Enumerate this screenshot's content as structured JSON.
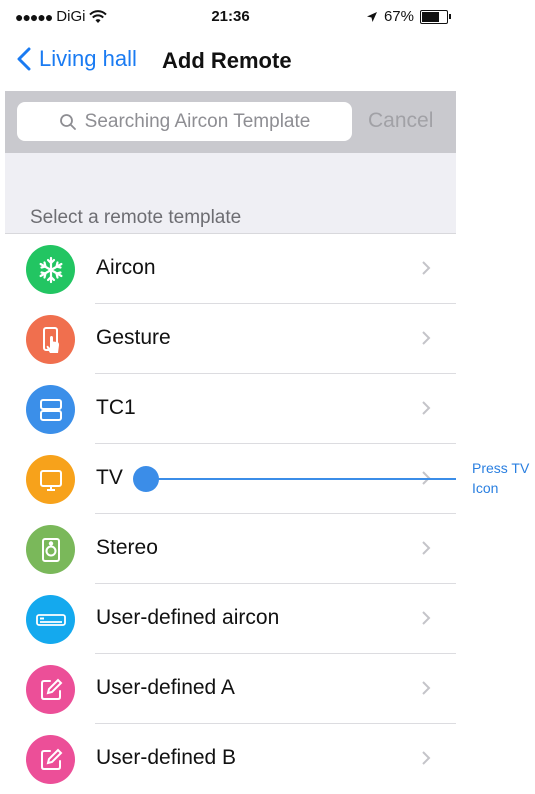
{
  "status_bar": {
    "signal": "●●●●●",
    "carrier": "DiGi",
    "time": "21:36",
    "battery": "67%",
    "battery_level": 0.67
  },
  "nav": {
    "back_label": "Living hall",
    "title": "Add Remote"
  },
  "search": {
    "placeholder": "Searching Aircon Template",
    "cancel_label": "Cancel"
  },
  "section_header": "Select a remote template",
  "items": [
    {
      "label": "Aircon",
      "icon": "snowflake-icon",
      "color": "#22c562"
    },
    {
      "label": "Gesture",
      "icon": "gesture-phone-icon",
      "color": "#f06f4e"
    },
    {
      "label": "TC1",
      "icon": "panels-icon",
      "color": "#3b8fe9"
    },
    {
      "label": "TV",
      "icon": "tv-icon",
      "color": "#f7a21b"
    },
    {
      "label": "Stereo",
      "icon": "speaker-icon",
      "color": "#7ab85a"
    },
    {
      "label": "User-defined aircon",
      "icon": "aircon-unit-icon",
      "color": "#14a9ee"
    },
    {
      "label": "User-defined A",
      "icon": "edit-icon",
      "color": "#ec4f98"
    },
    {
      "label": "User-defined B",
      "icon": "edit-icon",
      "color": "#ec4f98"
    }
  ],
  "annotation": {
    "line1": "Press TV",
    "line2": "Icon",
    "color": "#3b8de8"
  }
}
